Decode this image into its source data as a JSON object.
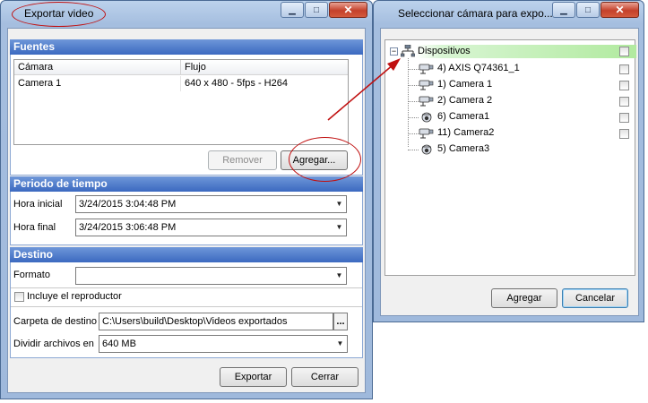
{
  "export_window": {
    "title": "Exportar video",
    "sources": {
      "header": "Fuentes",
      "columns": [
        "Cámara",
        "Flujo"
      ],
      "rows": [
        {
          "camera": "Camera 1",
          "stream": "640 x 480 - 5fps - H264"
        }
      ],
      "remove_label": "Remover",
      "add_label": "Agregar..."
    },
    "time_period": {
      "header": "Periodo de tiempo",
      "start_label": "Hora inicial",
      "start_value": "3/24/2015 3:04:48 PM",
      "end_label": "Hora final",
      "end_value": "3/24/2015 3:06:48 PM"
    },
    "destination": {
      "header": "Destino",
      "format_label": "Formato",
      "format_value": "",
      "include_player_label": "Incluye el reproductor",
      "include_player_checked": false,
      "folder_label": "Carpeta de destino",
      "folder_value": "C:\\Users\\build\\Desktop\\Videos exportados",
      "browse_label": "...",
      "split_label": "Dividir archivos en",
      "split_value": "640 MB"
    },
    "export_label": "Exportar",
    "close_label": "Cerrar"
  },
  "select_window": {
    "title": "Seleccionar cámara para expo...",
    "tree": {
      "root_label": "Dispositivos",
      "expander": "−",
      "items": [
        {
          "label": "4) AXIS Q74361_1",
          "icon": "box-camera-icon"
        },
        {
          "label": "1) Camera 1",
          "icon": "box-camera-icon"
        },
        {
          "label": "2) Camera 2",
          "icon": "box-camera-icon"
        },
        {
          "label": "6) Camera1",
          "icon": "dome-camera-icon"
        },
        {
          "label": "11) Camera2",
          "icon": "box-camera-icon"
        },
        {
          "label": "5) Camera3",
          "icon": "dome-camera-icon"
        }
      ]
    },
    "add_label": "Agregar",
    "cancel_label": "Cancelar"
  },
  "colors": {
    "group_header": "#3b69c0",
    "annotation_red": "#c01010",
    "tree_root_highlight": "#9fe39a"
  }
}
